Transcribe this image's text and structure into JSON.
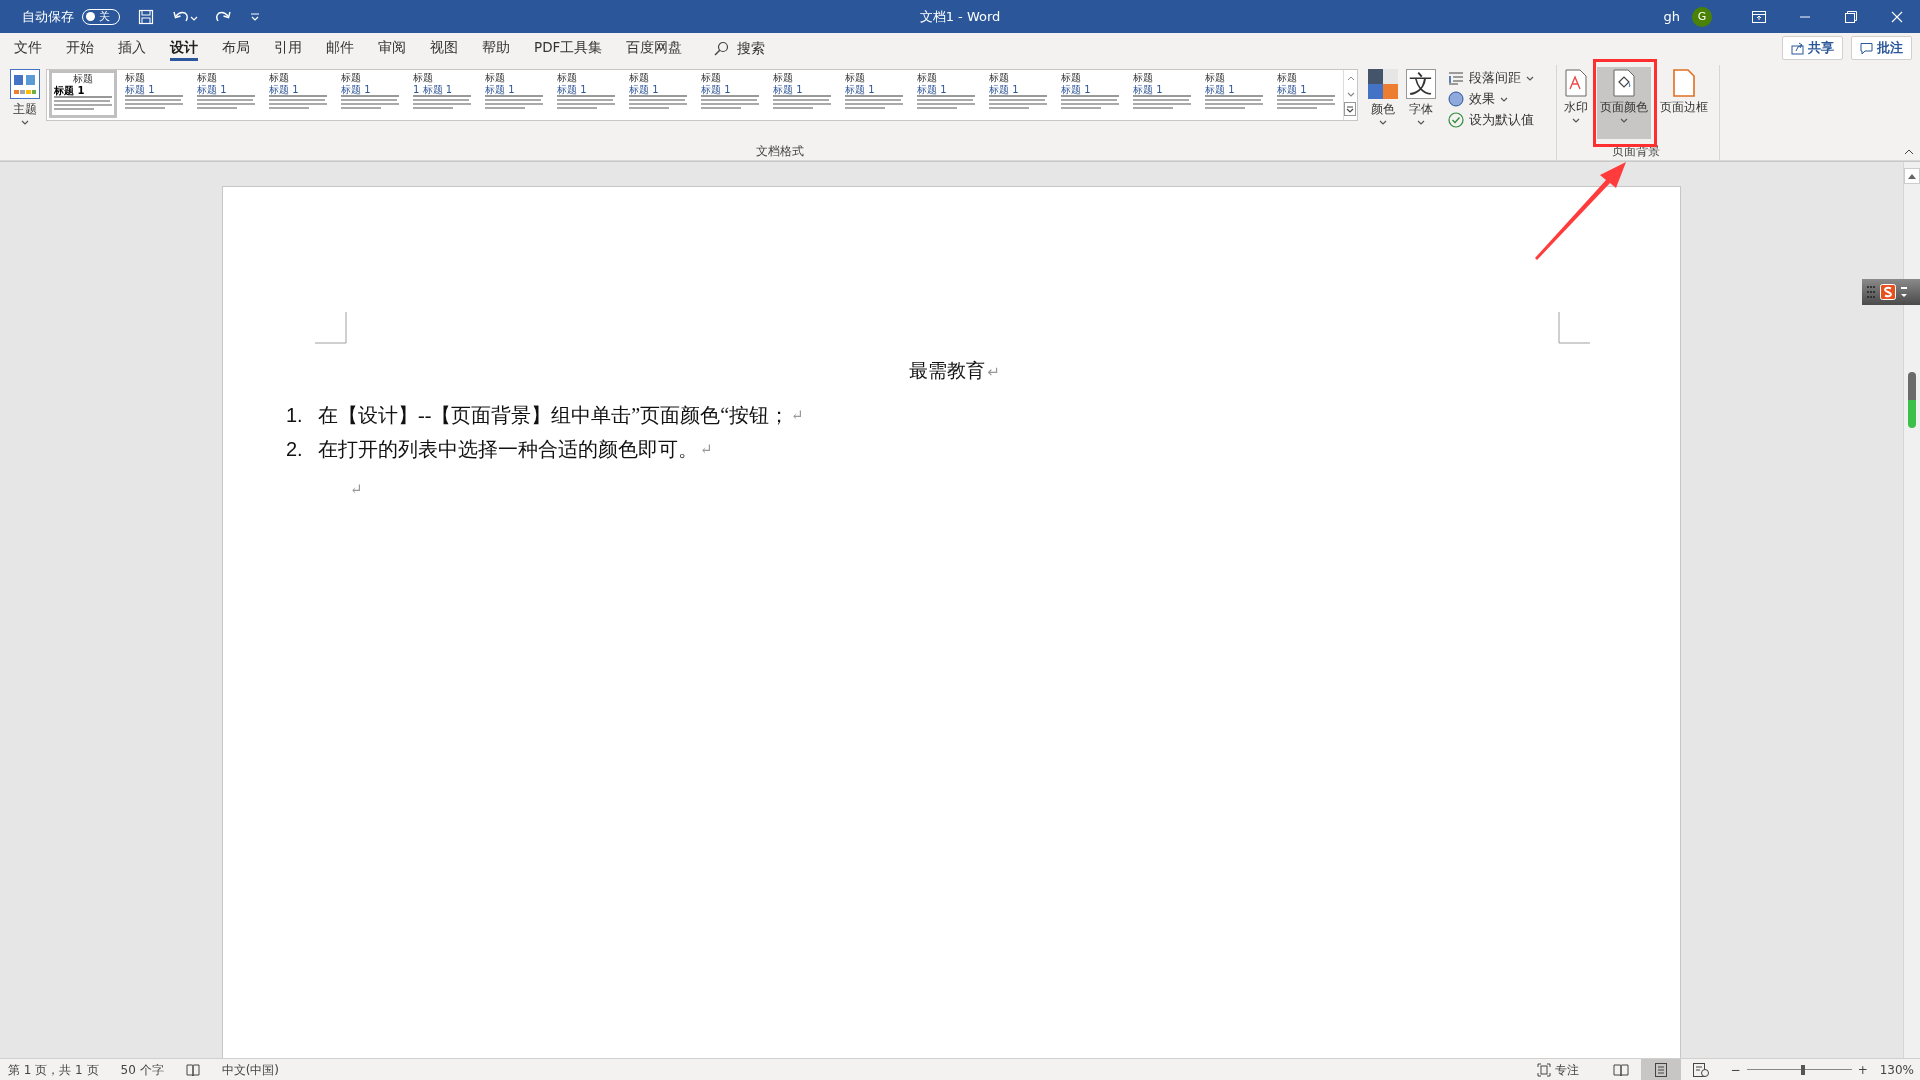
{
  "title_bar": {
    "autosave_label": "自动保存",
    "autosave_on": false,
    "autosave_state": "关",
    "doc_title": "文档1 - Word",
    "user": "gh",
    "avatar_initial": "G"
  },
  "menu_tabs": [
    {
      "label": "文件",
      "selected": false
    },
    {
      "label": "开始",
      "selected": false
    },
    {
      "label": "插入",
      "selected": false
    },
    {
      "label": "设计",
      "selected": true
    },
    {
      "label": "布局",
      "selected": false
    },
    {
      "label": "引用",
      "selected": false
    },
    {
      "label": "邮件",
      "selected": false
    },
    {
      "label": "审阅",
      "selected": false
    },
    {
      "label": "视图",
      "selected": false
    },
    {
      "label": "帮助",
      "selected": false
    },
    {
      "label": "PDF工具集",
      "selected": false
    },
    {
      "label": "百度网盘",
      "selected": false
    }
  ],
  "search": {
    "placeholder": "搜索"
  },
  "share_button": "共享",
  "comments_button": "批注",
  "ribbon": {
    "theme_button": "主题",
    "style_gallery": [
      {
        "title": "标题",
        "heading": "标题 1",
        "selected": true
      },
      {
        "title": "标题",
        "heading": "标题 1",
        "selected": false
      },
      {
        "title": "标题",
        "heading": "标题 1",
        "selected": false
      },
      {
        "title": "标题",
        "heading": "标题 1",
        "selected": false
      },
      {
        "title": "标题",
        "heading": "标题 1",
        "selected": false
      },
      {
        "title": "标题",
        "heading": "1 标题 1",
        "selected": false
      },
      {
        "title": "标题",
        "heading": "标题 1",
        "selected": false
      },
      {
        "title": "标题",
        "heading": "标题 1",
        "selected": false
      },
      {
        "title": "标题",
        "heading": "标题 1",
        "selected": false
      },
      {
        "title": "标题",
        "heading": "标题 1",
        "selected": false
      },
      {
        "title": "标题",
        "heading": "标题 1",
        "selected": false
      },
      {
        "title": "标题",
        "heading": "标题 1",
        "selected": false
      },
      {
        "title": "标题",
        "heading": "标题 1",
        "selected": false
      },
      {
        "title": "标题",
        "heading": "标题 1",
        "selected": false
      },
      {
        "title": "标题",
        "heading": "标题 1",
        "selected": false
      },
      {
        "title": "标题",
        "heading": "标题 1",
        "selected": false
      },
      {
        "title": "标题",
        "heading": "标题 1",
        "selected": false
      },
      {
        "title": "标题",
        "heading": "标题 1",
        "selected": false
      }
    ],
    "colors_button": "颜色",
    "fonts_button": "字体",
    "fonts_icon_char": "文",
    "paragraph_spacing": "段落间距",
    "effects": "效果",
    "set_default": "设为默认值",
    "document_format_label": "文档格式",
    "page_background": [
      {
        "kind": "watermark",
        "label": "水印",
        "selected": false
      },
      {
        "kind": "page_color",
        "label": "页面颜色",
        "selected": true
      },
      {
        "kind": "page_borders",
        "label": "页面边框",
        "selected": false
      }
    ],
    "page_background_label": "页面背景"
  },
  "document": {
    "title": "最需教育",
    "paragraph_mark": "↵",
    "list": [
      {
        "number": "1.",
        "text": "在【设计】--【页面背景】组中单击”页面颜色“按钮；"
      },
      {
        "number": "2.",
        "text": "在打开的列表中选择一种合适的颜色即可。"
      }
    ]
  },
  "status_bar": {
    "page": "第 1 页，共 1 页",
    "words": "50 个字",
    "language": "中文(中国)",
    "focus": "专注",
    "views": [
      {
        "kind": "read",
        "selected": false
      },
      {
        "kind": "print",
        "selected": true
      },
      {
        "kind": "web",
        "selected": false
      }
    ],
    "zoom_out": "−",
    "zoom_in": "+",
    "zoom": {
      "level": 0.54
    },
    "zoom_text": "130%"
  }
}
